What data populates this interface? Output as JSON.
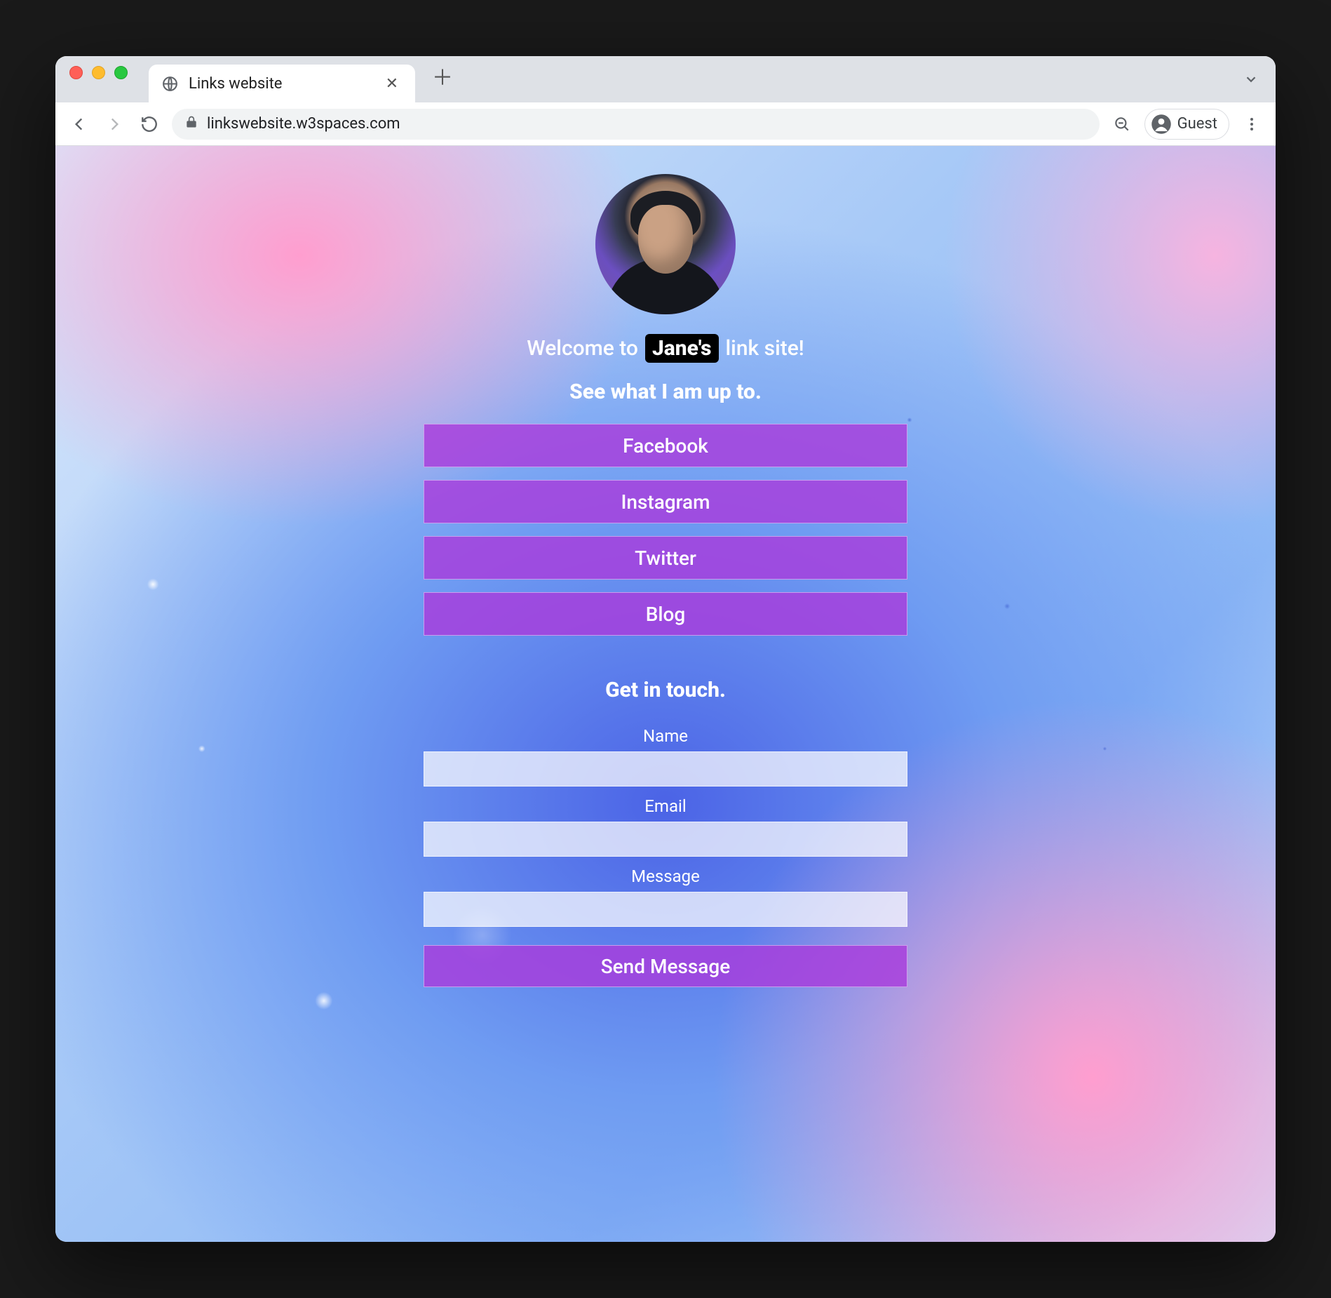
{
  "browser": {
    "tab_title": "Links website",
    "url": "linkswebsite.w3spaces.com",
    "guest_label": "Guest"
  },
  "page": {
    "welcome_before": "Welcome to",
    "welcome_name": "Jane's",
    "welcome_after": "link site!",
    "subtitle": "See what I am up to.",
    "links": [
      {
        "label": "Facebook"
      },
      {
        "label": "Instagram"
      },
      {
        "label": "Twitter"
      },
      {
        "label": "Blog"
      }
    ],
    "contact_heading": "Get in touch.",
    "form": {
      "name_label": "Name",
      "email_label": "Email",
      "message_label": "Message",
      "submit_label": "Send Message"
    }
  }
}
